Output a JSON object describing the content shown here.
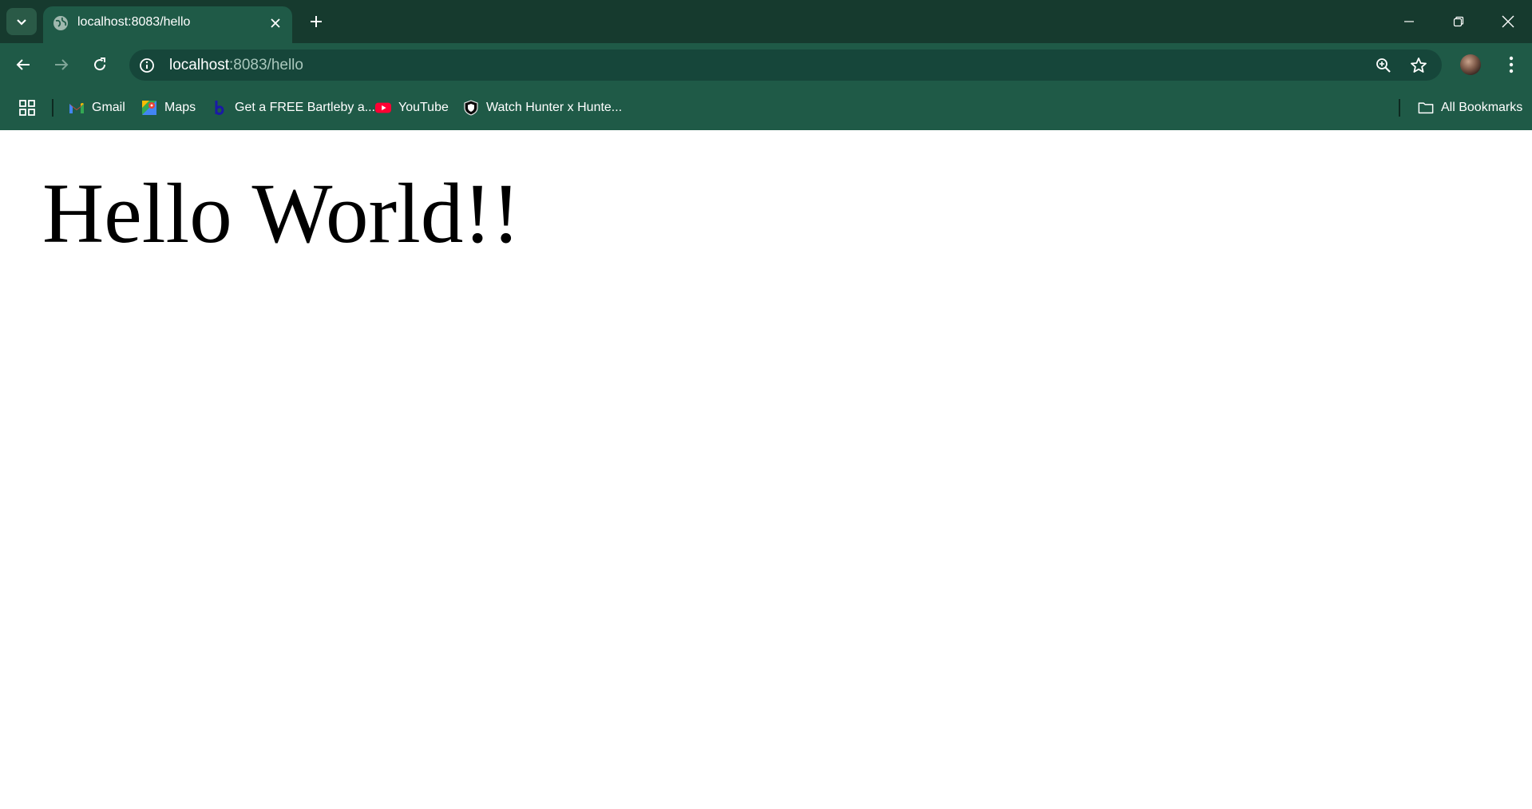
{
  "browser": {
    "tab": {
      "title": "localhost:8083/hello",
      "favicon": "globe-icon"
    },
    "address_bar": {
      "host": "localhost",
      "path": ":8083/hello"
    },
    "bookmarks": [
      {
        "label": "Gmail",
        "icon": "gmail-icon"
      },
      {
        "label": "Maps",
        "icon": "maps-icon"
      },
      {
        "label": "Get a FREE Bartleby a...",
        "icon": "bartleby-icon"
      },
      {
        "label": "YouTube",
        "icon": "youtube-icon"
      },
      {
        "label": "Watch Hunter x Hunte...",
        "icon": "shield-icon"
      }
    ],
    "all_bookmarks_label": "All Bookmarks",
    "colors": {
      "tabstrip": "#163a2e",
      "toolbar": "#1f5a47",
      "omnibox": "#16463a"
    }
  },
  "page": {
    "heading": "Hello World!!"
  }
}
